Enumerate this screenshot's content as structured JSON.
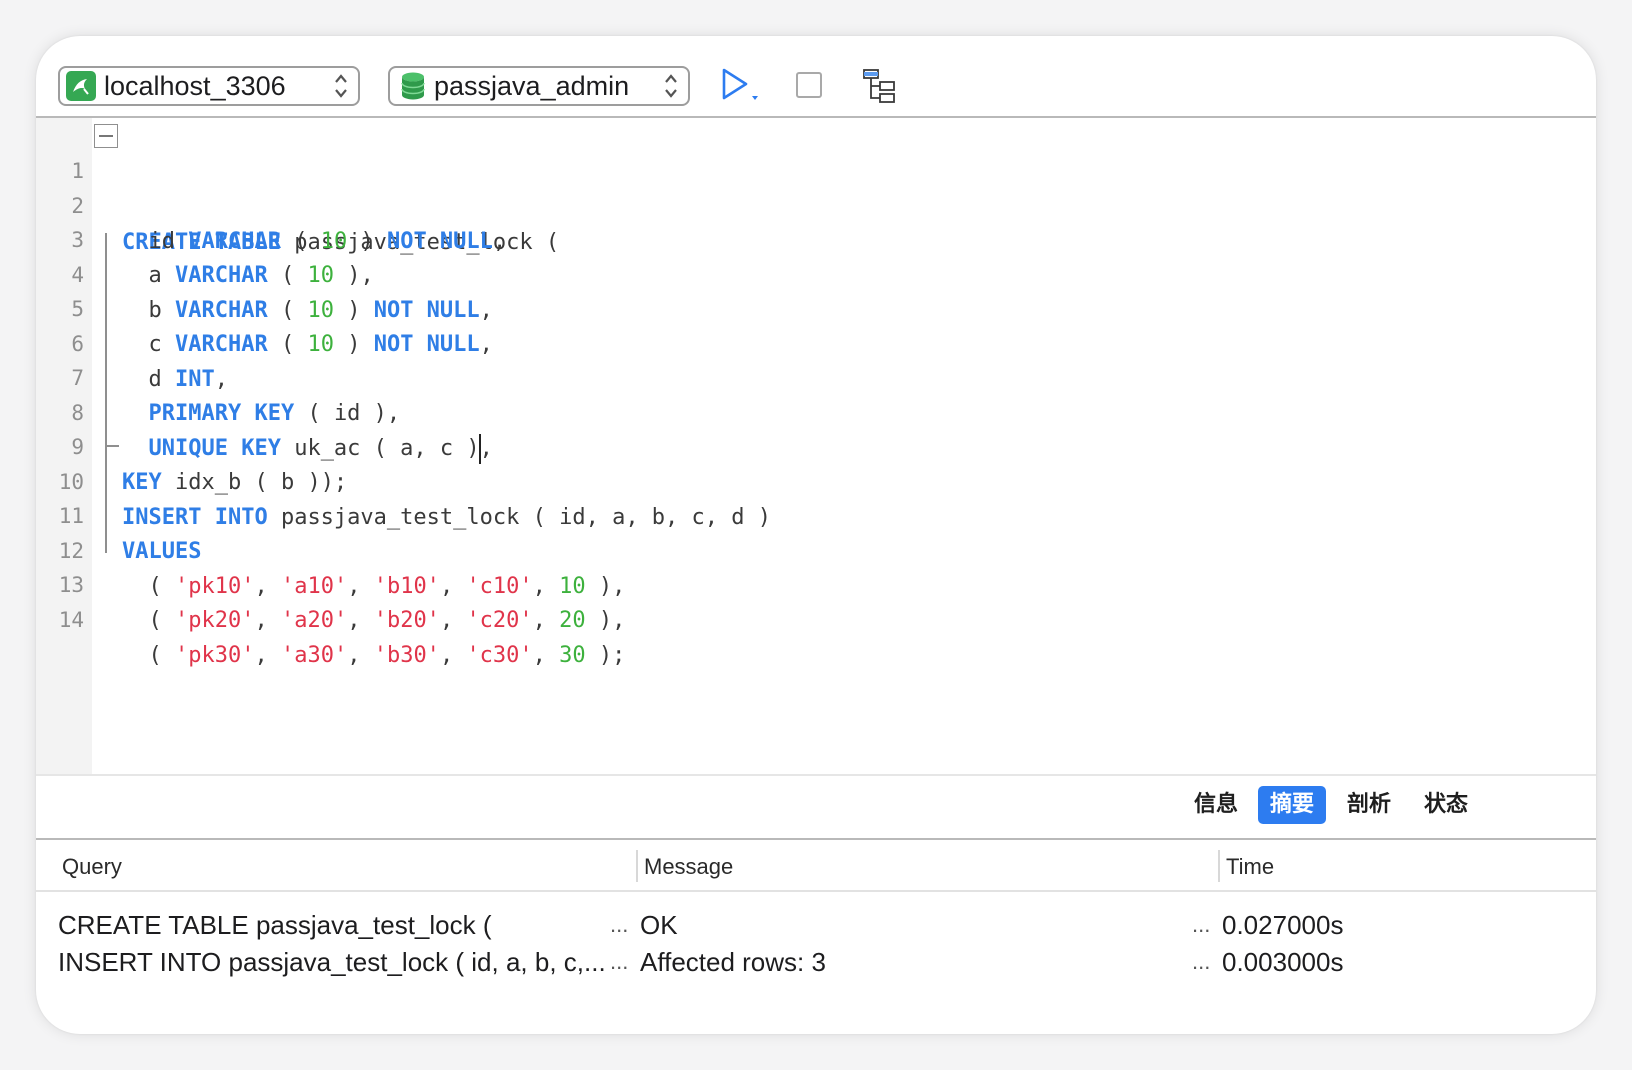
{
  "toolbar": {
    "connection": "localhost_3306",
    "database": "passjava_admin",
    "icons": [
      "mysql-connection-icon",
      "database-icon",
      "run-icon",
      "stop-icon",
      "explain-icon"
    ],
    "colors": {
      "run": "#2d7cf0",
      "connection": "#35a853",
      "database": "#35a853"
    }
  },
  "editor": {
    "line_numbers": [
      "1",
      "2",
      "3",
      "4",
      "5",
      "6",
      "7",
      "8",
      "9",
      "10",
      "11",
      "12",
      "13",
      "14"
    ]
  },
  "tabs": {
    "info": "信息",
    "summary": "摘要",
    "profile": "剖析",
    "status": "状态",
    "active_color": "#2d7cf0"
  },
  "results": {
    "headers": {
      "query": "Query",
      "message": "Message",
      "time": "Time"
    },
    "rows": [
      {
        "query": "CREATE TABLE passjava_test_lock (",
        "message": "OK",
        "time": "0.027000s"
      },
      {
        "query": "INSERT INTO passjava_test_lock ( id, a, b, c,...",
        "message": "Affected rows: 3",
        "time": "0.003000s"
      }
    ],
    "ellipsis": "..."
  }
}
